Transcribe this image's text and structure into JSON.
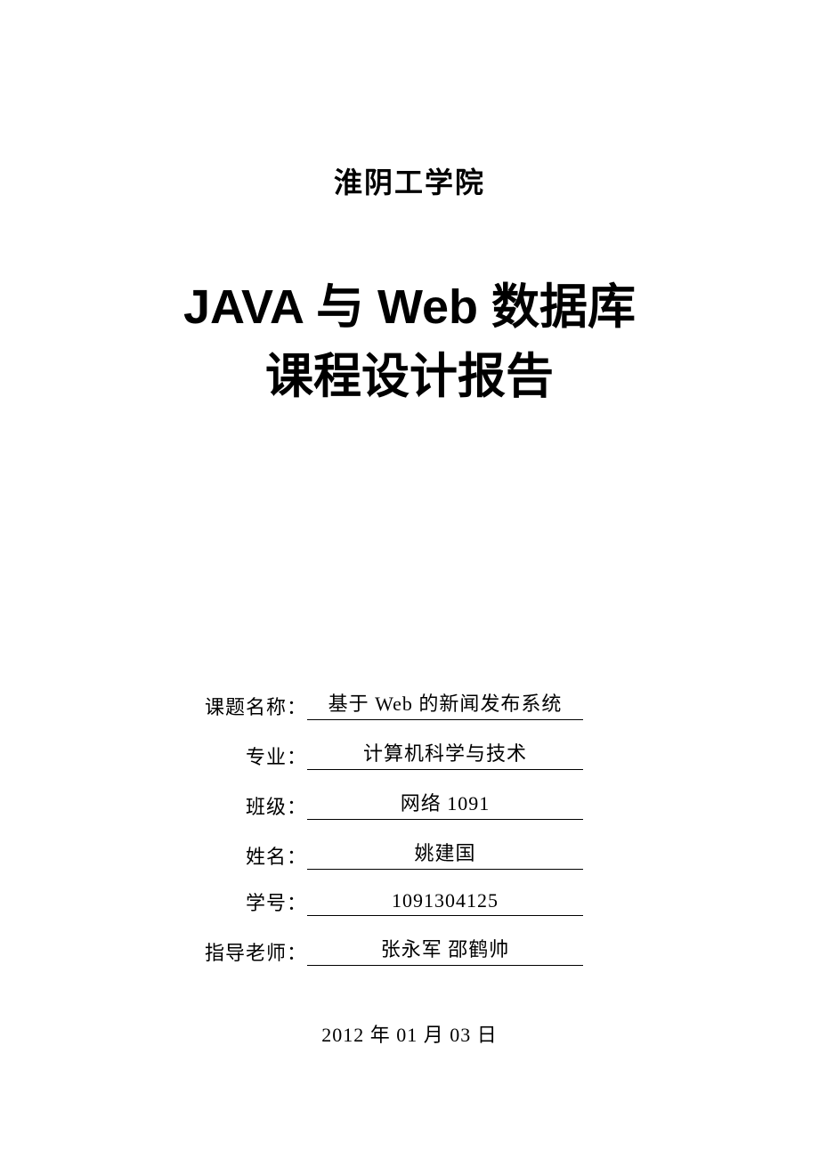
{
  "institution": "淮阴工学院",
  "main_title_line1": "JAVA 与 Web 数据库",
  "main_title_line2": "课程设计报告",
  "fields": [
    {
      "label": "课题名称：",
      "value": "基于 Web 的新闻发布系统"
    },
    {
      "label": "专业：",
      "value": "计算机科学与技术"
    },
    {
      "label": "班级：",
      "value": "网络 1091"
    },
    {
      "label": "姓名：",
      "value": "姚建国"
    },
    {
      "label": "学号：",
      "value": "1091304125"
    },
    {
      "label": "指导老师：",
      "value": "张永军 邵鹤帅"
    }
  ],
  "date": "2012 年 01 月 03 日"
}
